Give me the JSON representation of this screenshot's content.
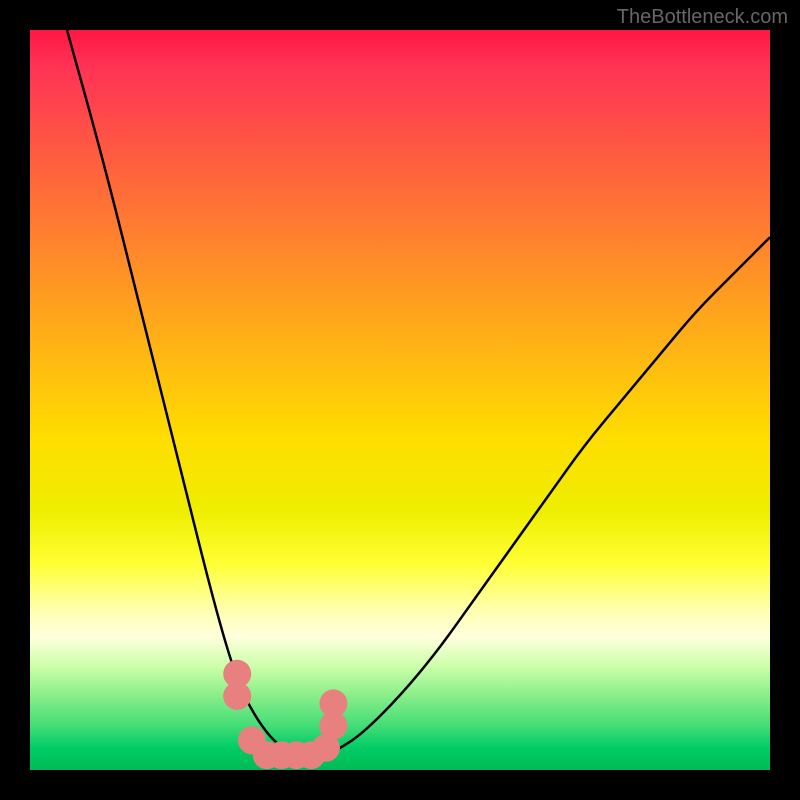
{
  "watermark": "TheBottleneck.com",
  "chart_data": {
    "type": "line",
    "title": "",
    "xlabel": "",
    "ylabel": "",
    "xlim": [
      0,
      100
    ],
    "ylim": [
      0,
      100
    ],
    "series": [
      {
        "name": "bottleneck-curve",
        "x": [
          5,
          10,
          15,
          20,
          25,
          28,
          30,
          32,
          34,
          36,
          38,
          40,
          42,
          45,
          50,
          55,
          60,
          65,
          70,
          75,
          80,
          85,
          90,
          95,
          100
        ],
        "values": [
          100,
          82,
          62,
          42,
          22,
          12,
          8,
          5,
          3,
          2,
          2,
          2,
          3,
          5,
          10,
          16,
          23,
          30,
          37,
          44,
          50,
          56,
          62,
          67,
          72
        ]
      }
    ],
    "markers": {
      "name": "data-points",
      "x": [
        28,
        28,
        30,
        32,
        34,
        36,
        38,
        40,
        41,
        41
      ],
      "values": [
        13,
        10,
        4,
        2,
        2,
        2,
        2,
        3,
        6,
        9
      ],
      "color": "#e88080",
      "size": 14
    },
    "gradient_zones": [
      {
        "position": 0,
        "color": "#ff1744",
        "meaning": "high-bottleneck"
      },
      {
        "position": 50,
        "color": "#ffdd00",
        "meaning": "medium-bottleneck"
      },
      {
        "position": 100,
        "color": "#00bb55",
        "meaning": "no-bottleneck"
      }
    ]
  }
}
